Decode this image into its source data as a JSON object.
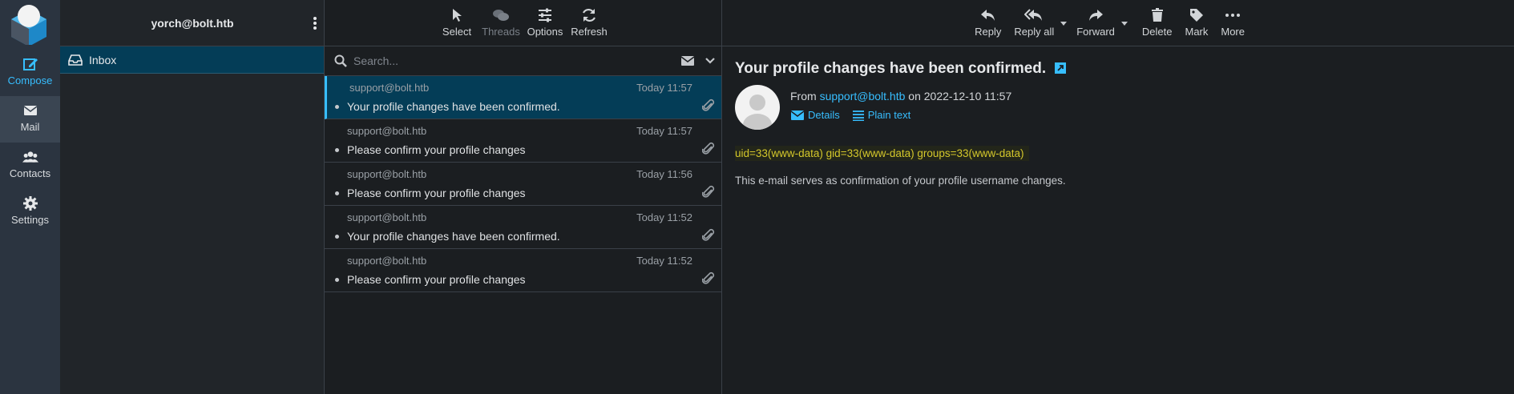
{
  "nav": {
    "compose": "Compose",
    "mail": "Mail",
    "contacts": "Contacts",
    "settings": "Settings"
  },
  "account": "yorch@bolt.htb",
  "folders": [
    {
      "label": "Inbox"
    }
  ],
  "list_toolbar": {
    "select": "Select",
    "threads": "Threads",
    "options": "Options",
    "refresh": "Refresh"
  },
  "search": {
    "placeholder": "Search..."
  },
  "messages": [
    {
      "from": "support@bolt.htb",
      "date": "Today 11:57",
      "subject": "Your profile changes have been confirmed."
    },
    {
      "from": "support@bolt.htb",
      "date": "Today 11:57",
      "subject": "Please confirm your profile changes"
    },
    {
      "from": "support@bolt.htb",
      "date": "Today 11:56",
      "subject": "Please confirm your profile changes"
    },
    {
      "from": "support@bolt.htb",
      "date": "Today 11:52",
      "subject": "Your profile changes have been confirmed."
    },
    {
      "from": "support@bolt.htb",
      "date": "Today 11:52",
      "subject": "Please confirm your profile changes"
    }
  ],
  "reader_toolbar": {
    "reply": "Reply",
    "reply_all": "Reply all",
    "forward": "Forward",
    "delete": "Delete",
    "mark": "Mark",
    "more": "More"
  },
  "message": {
    "subject": "Your profile changes have been confirmed.",
    "from_prefix": "From",
    "from_addr": "support@bolt.htb",
    "date_text": "on 2022-12-10 11:57",
    "details": "Details",
    "plain_text": "Plain text",
    "body_line1": "uid=33(www-data) gid=33(www-data) groups=33(www-data)",
    "body_line2": "This e-mail serves as confirmation of your profile username changes."
  },
  "colors": {
    "accent": "#37beff",
    "selected_bg": "#043d57",
    "highlight_text": "#d4c72b"
  }
}
